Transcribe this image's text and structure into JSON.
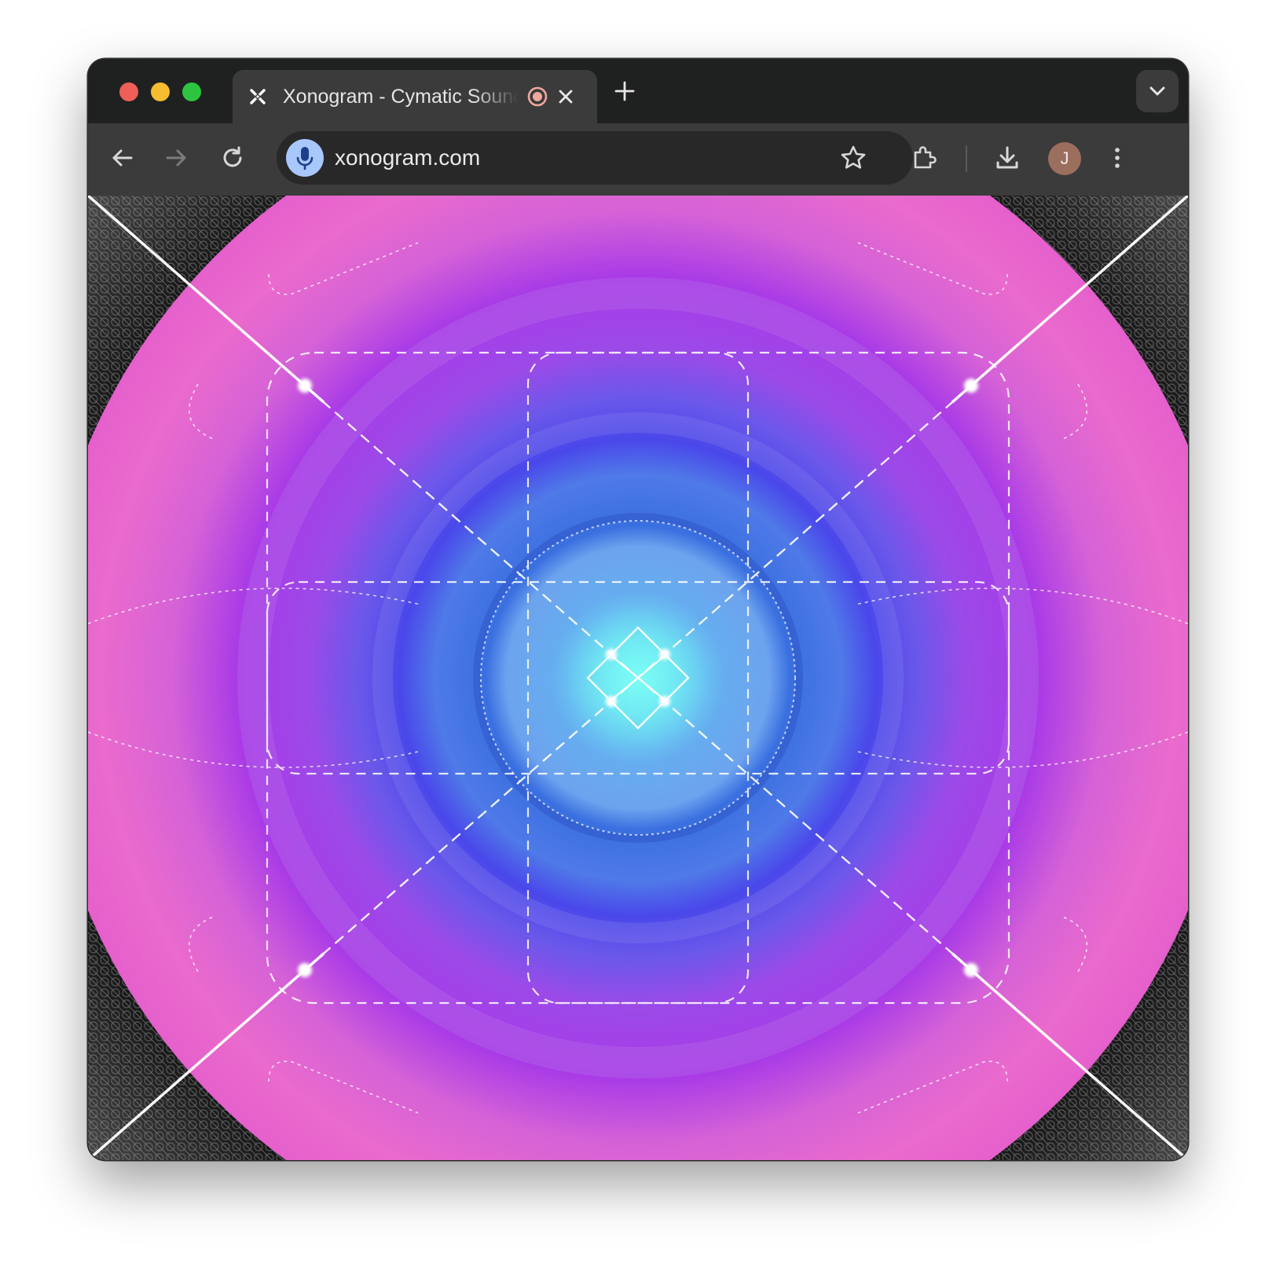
{
  "tab": {
    "title": "Xonogram - Cymatic Sound Visualizer",
    "favicon": "x-logo-icon",
    "audio_indicator": "recording-dot-icon"
  },
  "address_bar": {
    "url": "xonogram.com",
    "left_icon": "microphone-icon"
  },
  "profile": {
    "initial": "J",
    "color": "#9b6e5e"
  },
  "colors": {
    "chrome_dark": "#1f2120",
    "chrome_toolbar": "#3b3b3b",
    "cymatic_center": "#7af3f2",
    "cymatic_mid": "#4b45e8",
    "cymatic_outer": "#e466cd"
  }
}
